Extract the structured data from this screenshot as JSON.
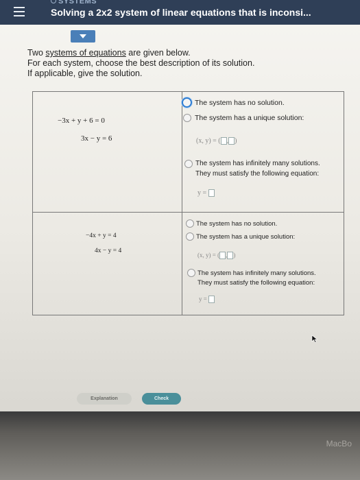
{
  "header": {
    "topic": "SYSTEMS",
    "title": "Solving a 2x2 system of linear equations that is inconsi..."
  },
  "intro": {
    "line1_pre": "Two ",
    "line1_link": "systems of equations",
    "line1_post": " are given below.",
    "line2": "For each system, choose the best description of its solution.",
    "line3": "If applicable, give the solution."
  },
  "systems": [
    {
      "eq1": "−3x + y + 6 = 0",
      "eq2": "3x − y = 6",
      "options": {
        "none": "The system has no solution.",
        "unique": "The system has a unique solution:",
        "unique_math": "(x, y) = (",
        "infinite1": "The system has infinitely many solutions.",
        "infinite2": "They must satisfy the following equation:",
        "infinite_math": "y ="
      },
      "selected": "none"
    },
    {
      "eq1": "−4x + y = 4",
      "eq2": "4x − y = 4",
      "options": {
        "none": "The system has no solution.",
        "unique": "The system has a unique solution:",
        "unique_math": "(x, y) = (",
        "infinite1": "The system has infinitely many solutions.",
        "infinite2": "They must satisfy the following equation:",
        "infinite_math": "y ="
      },
      "selected": null
    }
  ],
  "buttons": {
    "explanation": "Explanation",
    "check": "Check"
  },
  "bezel": {
    "brand": "MacBo"
  },
  "colors": {
    "header_bg": "#2f3f57",
    "accent_blue": "#4a7fb8",
    "check_button": "#4a8f9a"
  }
}
